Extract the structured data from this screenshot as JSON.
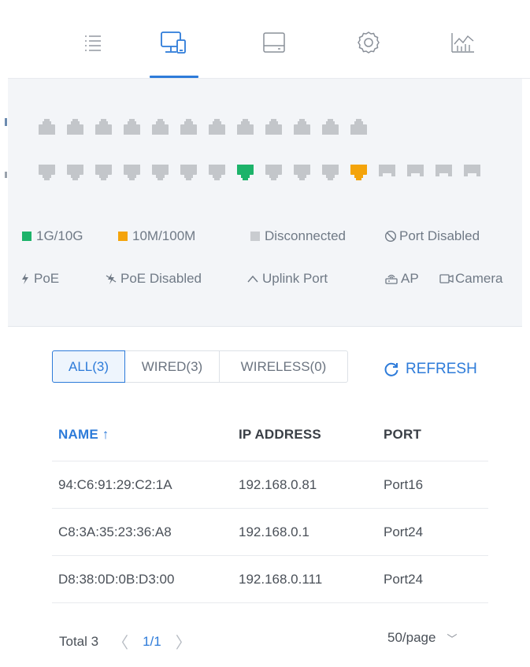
{
  "tabs": [
    {
      "icon": "list-icon",
      "active": false
    },
    {
      "icon": "devices-icon",
      "active": true
    },
    {
      "icon": "storage-icon",
      "active": false
    },
    {
      "icon": "gear-icon",
      "active": false
    },
    {
      "icon": "stats-icon",
      "active": false
    }
  ],
  "ports": {
    "top_row": [
      "off",
      "off",
      "off",
      "off",
      "off",
      "off",
      "off",
      "off",
      "off",
      "off",
      "off",
      "off"
    ],
    "bottom_row": [
      "off",
      "off",
      "off",
      "off",
      "off",
      "off",
      "off",
      "1g",
      "off",
      "off",
      "off",
      "10m",
      "off",
      "off",
      "off",
      "off"
    ]
  },
  "colors": {
    "accent": "#2d7bd9",
    "port_1g": "#1db36a",
    "port_10m": "#f4a40b",
    "port_off": "#c3c6ca"
  },
  "legend": {
    "g1": "1G/10G",
    "m10": "10M/100M",
    "disconnected": "Disconnected",
    "disabled": "Port Disabled",
    "poe": "PoE",
    "poe_disabled": "PoE Disabled",
    "uplink": "Uplink Port",
    "ap": "AP",
    "camera": "Camera"
  },
  "filter": {
    "all": "ALL(3)",
    "wired": "WIRED(3)",
    "wireless": "WIRELESS(0)"
  },
  "refresh_label": "REFRESH",
  "table": {
    "headers": {
      "name": "NAME ↑",
      "ip": "IP ADDRESS",
      "port": "PORT"
    },
    "rows": [
      {
        "name": "94:C6:91:29:C2:1A",
        "ip": "192.168.0.81",
        "port": "Port16"
      },
      {
        "name": "C8:3A:35:23:36:A8",
        "ip": "192.168.0.1",
        "port": "Port24"
      },
      {
        "name": "D8:38:0D:0B:D3:00",
        "ip": "192.168.0.111",
        "port": "Port24"
      }
    ]
  },
  "pagination": {
    "total": "Total 3",
    "prev": "〈",
    "current": "1/1",
    "next": "〉",
    "per_page": "50/page",
    "chevron": "﹀"
  }
}
